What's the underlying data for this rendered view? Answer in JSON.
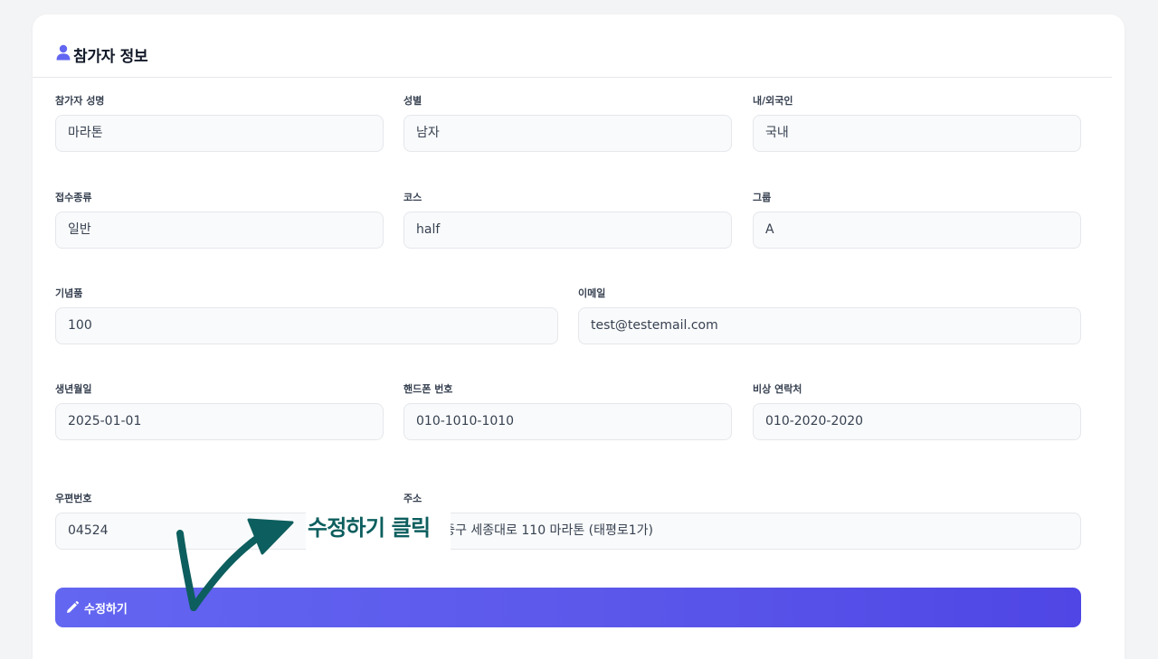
{
  "header": {
    "title": "참가자 정보",
    "icon": "user-icon",
    "icon_color": "#6366f1"
  },
  "fields": {
    "name": {
      "label": "참가자 성명",
      "value": "마라톤"
    },
    "gender": {
      "label": "성별",
      "value": "남자"
    },
    "nationality": {
      "label": "내/외국인",
      "value": "국내"
    },
    "registration_type": {
      "label": "접수종류",
      "value": "일반"
    },
    "course": {
      "label": "코스",
      "value": "half"
    },
    "group": {
      "label": "그룹",
      "value": "A"
    },
    "souvenir": {
      "label": "기념품",
      "value": "100"
    },
    "email": {
      "label": "이메일",
      "value": "test@testemail.com"
    },
    "birthdate": {
      "label": "생년월일",
      "value": "2025-01-01"
    },
    "phone": {
      "label": "핸드폰 번호",
      "value": "010-1010-1010"
    },
    "emergency_contact": {
      "label": "비상 연락처",
      "value": "010-2020-2020"
    },
    "postal_code": {
      "label": "우편번호",
      "value": "04524"
    },
    "address": {
      "label": "주소",
      "value": "서울 중구 세종대로 110 마라톤 (태평로1가)"
    }
  },
  "submit": {
    "label": "수정하기",
    "icon": "pencil-icon",
    "gradient_start": "#6366f1",
    "gradient_end": "#4f46e5"
  },
  "annotation": {
    "text": "수정하기 클릭",
    "color": "#0d5e5e"
  }
}
